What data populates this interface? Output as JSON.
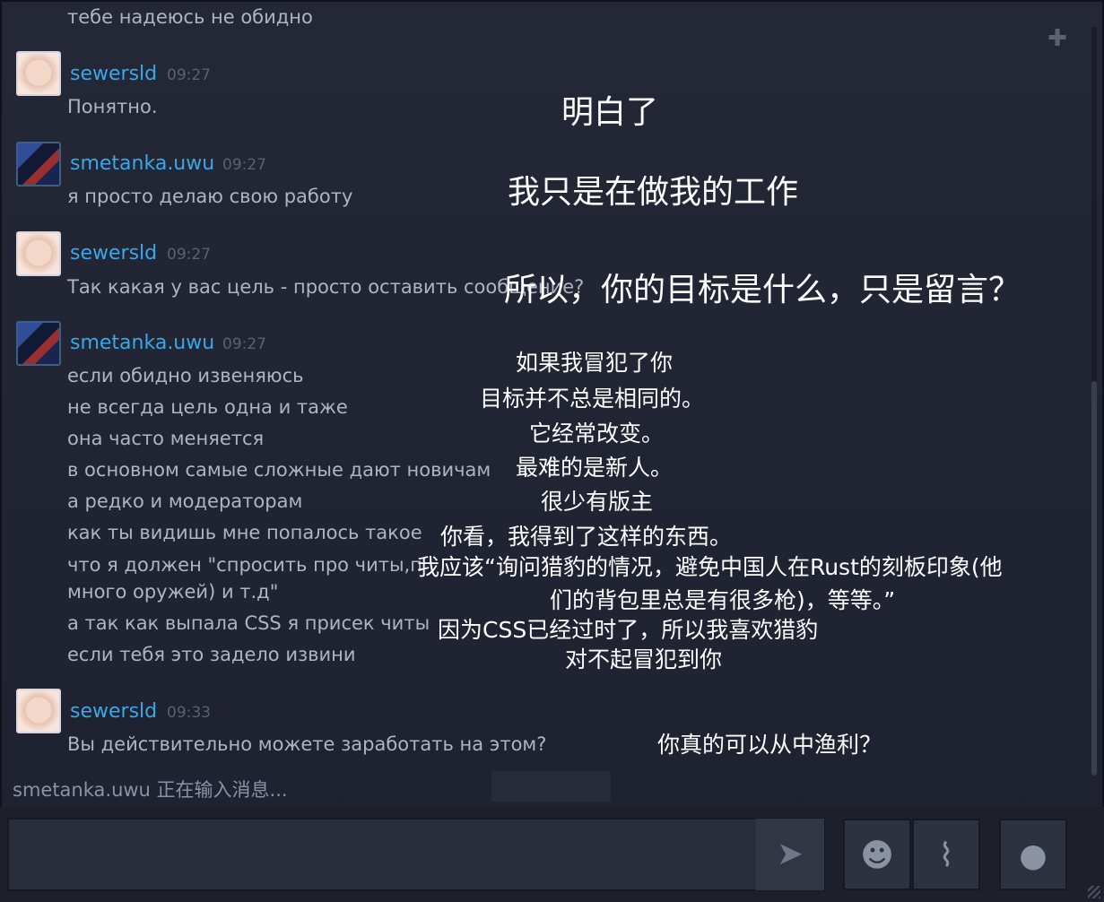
{
  "messages": [
    {
      "text": "тебе надеюсь не обидно"
    },
    {
      "user": "sewersld",
      "time": "09:27",
      "lines": [
        "Понятно."
      ]
    },
    {
      "user": "smetanka.uwu",
      "time": "09:27",
      "lines": [
        "я просто делаю свою работу"
      ]
    },
    {
      "user": "sewersld",
      "time": "09:27",
      "lines": [
        "Так какая у вас цель - просто оставить сообщение?"
      ]
    },
    {
      "user": "smetanka.uwu",
      "time": "09:27",
      "lines": [
        "если обидно извеняюсь",
        "не всегда цель одна и таже",
        "она часто меняется",
        "в основном самые сложные дают новичам",
        "а редко и модераторам",
        "как ты видишь мне попалось такое",
        "что я должен \"спросить про читы,п",
        "много оружей) и т.д\"",
        "а так как выпала CSS я присек читы",
        "если тебя это задело извини"
      ]
    },
    {
      "user": "sewersld",
      "time": "09:33",
      "lines": [
        "Вы действительно можете заработать на этом?"
      ]
    }
  ],
  "overlays": [
    "明白了",
    "我只是在做我的工作",
    "所以，你的目标是什么，只是留言？",
    "如果我冒犯了你",
    "目标并不总是相同的。",
    "它经常改变。",
    "最难的是新人。",
    "很少有版主",
    "你看，我得到了这样的东西。",
    "我应该“询问猎豹的情况，避免中国人在Rust的刻板印象(他",
    "们的背包里总是有很多枪)，等等。”",
    "因为CSS已经过时了，所以我喜欢猎豹",
    "对不起冒犯到你",
    "你真的可以从中渔利？"
  ],
  "typing_status": "smetanka.uwu 正在输入消息...",
  "icons": {
    "invite": "add-friend-icon",
    "send": "send-icon",
    "emoji": "emoji-icon",
    "attach": "paperclip-icon",
    "voice": "microphone-icon"
  }
}
